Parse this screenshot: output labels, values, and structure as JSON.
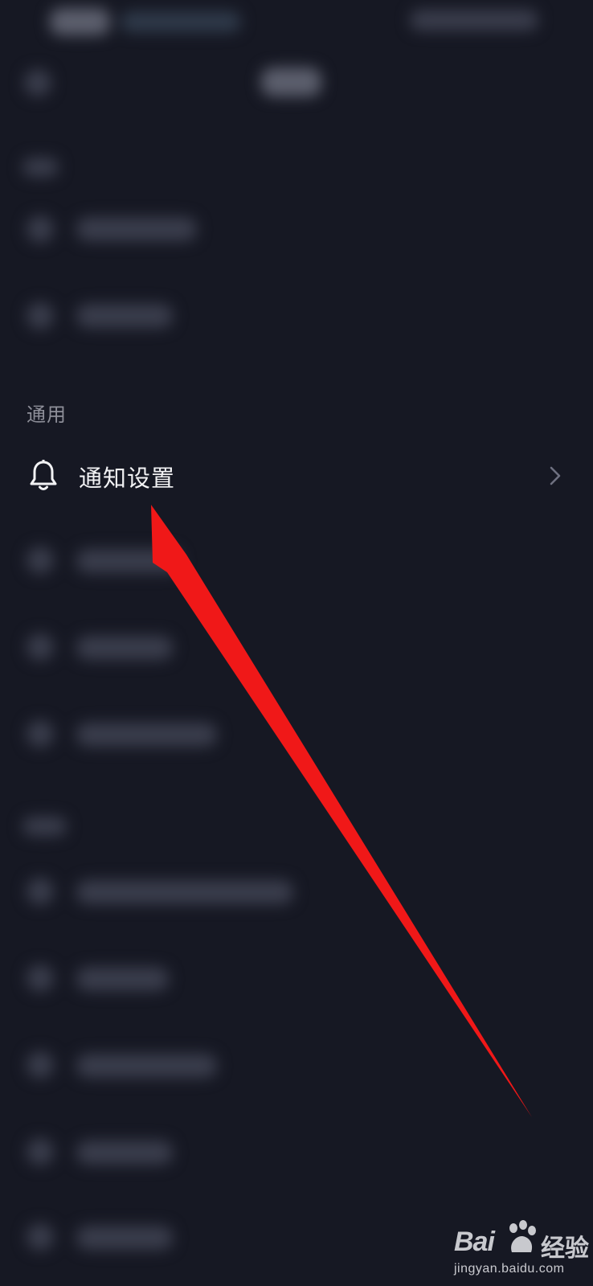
{
  "section": {
    "title": "通用"
  },
  "notification_row": {
    "label": "通知设置",
    "icon": "bell-icon",
    "trailing_icon": "chevron-right-icon"
  },
  "annotation": {
    "arrow_color": "#f01818"
  },
  "watermark": {
    "brand": "Bai",
    "brand_suffix": "经验",
    "url": "jingyan.baidu.com"
  },
  "colors": {
    "background": "#161823",
    "text_primary": "#f2f2f4",
    "text_secondary": "#8e8f99"
  }
}
